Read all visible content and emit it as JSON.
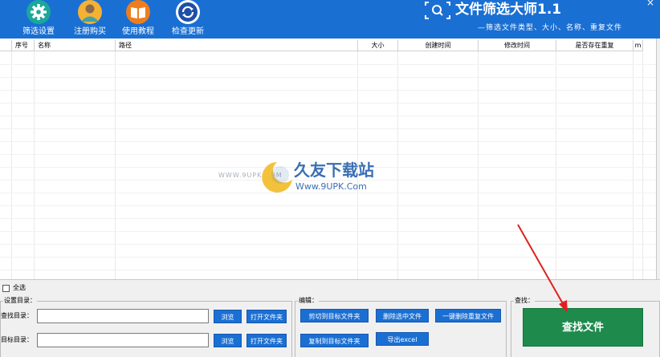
{
  "toolbar": {
    "items": [
      {
        "label": "筛选设置",
        "icon": "gear-icon"
      },
      {
        "label": "注册购买",
        "icon": "user-icon"
      },
      {
        "label": "使用教程",
        "icon": "book-icon"
      },
      {
        "label": "检查更新",
        "icon": "refresh-icon"
      }
    ]
  },
  "brand": {
    "title": "文件筛选大师1.1",
    "subtitle": "—筛选文件类型、大小、名称、重复文件",
    "icon": "search-scan-icon"
  },
  "window": {
    "close_label": "×"
  },
  "table": {
    "columns": [
      "",
      "序号",
      "名称",
      "路径",
      "大小",
      "创建时间",
      "修改时间",
      "是否存在重复",
      "m"
    ]
  },
  "watermark": {
    "prefix": "WWW.9UPK.COM",
    "name": "久友下载站",
    "url": "Www.9UPK.Com"
  },
  "bottom": {
    "select_all": "全选",
    "settings": {
      "title": "设置目录：",
      "search_dir_label": "查找目录：",
      "target_dir_label": "目标目录：",
      "search_dir_value": "",
      "target_dir_value": "",
      "browse_label": "浏览",
      "open_folder_label": "打开文件夹"
    },
    "edit": {
      "title": "编辑：",
      "cut_label": "剪切到目标文件夹",
      "delete_selected_label": "删除选中文件",
      "delete_duplicates_label": "一键删除重复文件",
      "copy_label": "复制到目标文件夹",
      "export_label": "导出excel"
    },
    "find": {
      "title": "查找：",
      "button_label": "查找文件"
    }
  },
  "colors": {
    "header_bg": "#1a6fd3",
    "button_blue": "#1a6fd3",
    "find_button": "#1e8b4c",
    "arrow": "#e02020"
  }
}
